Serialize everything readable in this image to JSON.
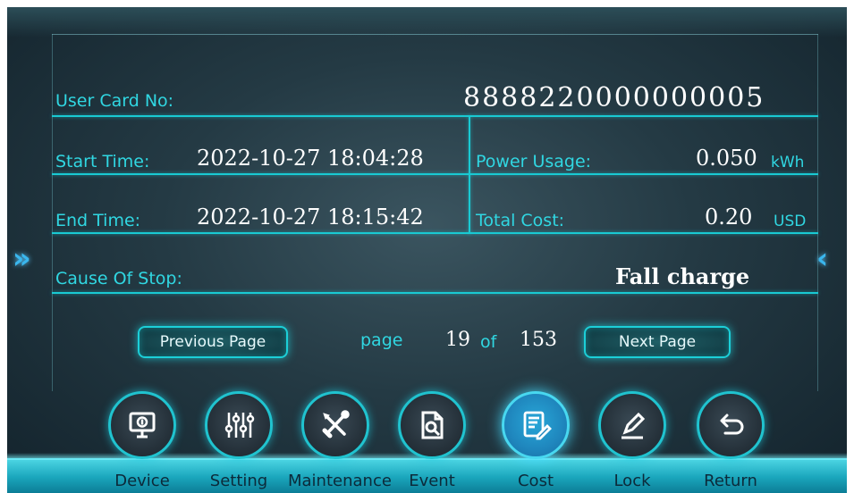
{
  "record": {
    "card_label": "User Card No:",
    "card_value": "8888220000000005",
    "start_label": "Start Time:",
    "start_value": "2022-10-27 18:04:28",
    "end_label": "End Time:",
    "end_value": "2022-10-27 18:15:42",
    "power_label": "Power Usage:",
    "power_value": "0.050",
    "power_unit": "kWh",
    "cost_label": "Total Cost:",
    "cost_value": "0.20",
    "cost_unit": "USD",
    "cause_label": "Cause Of Stop:",
    "cause_value": "Fall charge"
  },
  "pagination": {
    "prev_label": "Previous Page",
    "page_word": "page",
    "current": "19",
    "of_word": "of",
    "total": "153",
    "next_label": "Next Page"
  },
  "nav": [
    {
      "label": "Device",
      "icon": "monitor-icon",
      "active": false
    },
    {
      "label": "Setting",
      "icon": "sliders-icon",
      "active": false
    },
    {
      "label": "Maintenance",
      "icon": "tools-icon",
      "active": false
    },
    {
      "label": "Event",
      "icon": "doc-search-icon",
      "active": false
    },
    {
      "label": "Cost",
      "icon": "bill-edit-icon",
      "active": true
    },
    {
      "label": "Lock",
      "icon": "pencil-icon",
      "active": false
    },
    {
      "label": "Return",
      "icon": "return-icon",
      "active": false
    }
  ],
  "colors": {
    "accent": "#19cad3",
    "label": "#30d7e2",
    "active_button": "#1f86bd"
  }
}
